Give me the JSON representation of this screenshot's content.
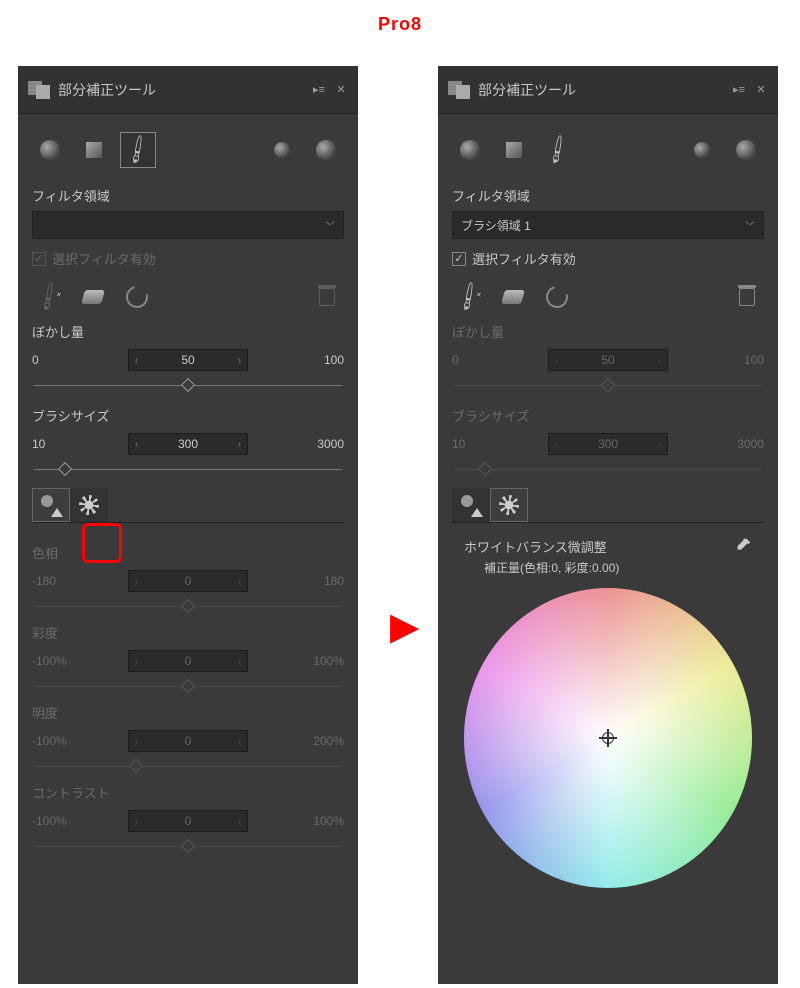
{
  "page_label": "Pro8",
  "panels": {
    "left": {
      "title": "部分補正ツール",
      "filter_area_label": "フィルタ領域",
      "filter_area_value": "",
      "checkbox_label": "選択フィルタ有効",
      "checkbox_checked": true,
      "blur": {
        "label": "ぼかし量",
        "min": "0",
        "value": "50",
        "max": "100",
        "pos": 50
      },
      "brush": {
        "label": "ブラシサイズ",
        "min": "10",
        "value": "300",
        "max": "3000",
        "pos": 10
      },
      "adjustments": [
        {
          "label": "色相",
          "min": "-180",
          "value": "0",
          "max": "180",
          "pos": 50
        },
        {
          "label": "彩度",
          "min": "-100%",
          "value": "0",
          "max": "100%",
          "pos": 50
        },
        {
          "label": "明度",
          "min": "-100%",
          "value": "0",
          "max": "200%",
          "pos": 33
        },
        {
          "label": "コントラスト",
          "min": "-100%",
          "value": "0",
          "max": "100%",
          "pos": 50
        }
      ]
    },
    "right": {
      "title": "部分補正ツール",
      "filter_area_label": "フィルタ領域",
      "filter_area_value": "ブラシ領域 1",
      "checkbox_label": "選択フィルタ有効",
      "checkbox_checked": true,
      "blur": {
        "label": "ぼかし量",
        "min": "0",
        "value": "50",
        "max": "100",
        "pos": 50
      },
      "brush": {
        "label": "ブラシサイズ",
        "min": "10",
        "value": "300",
        "max": "3000",
        "pos": 10
      },
      "wb": {
        "title": "ホワイトバランス微調整",
        "subtitle": "補正量(色相:0, 彩度:0.00)"
      }
    }
  }
}
